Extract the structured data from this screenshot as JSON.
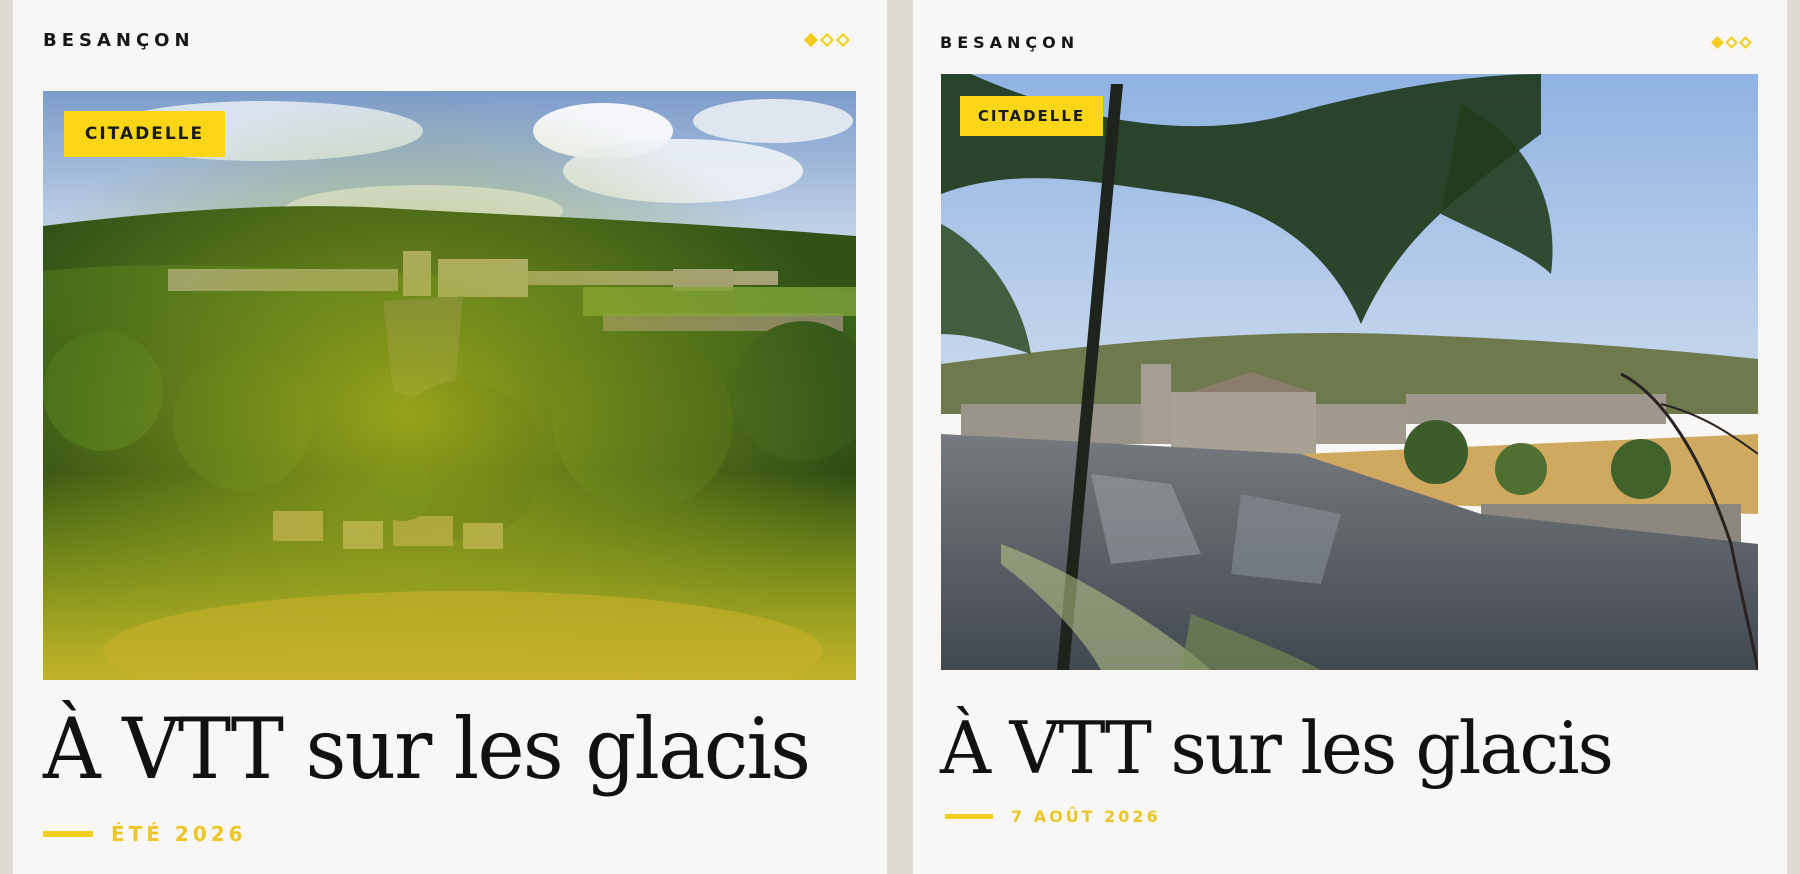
{
  "cards": [
    {
      "brand": "BESANÇON",
      "tag": "CITADELLE",
      "title": "À VTT sur les glacis",
      "date": "ÉTÉ 2026",
      "photo": "citadel-on-green-hillside"
    },
    {
      "brand": "BESANÇON",
      "tag": "CITADELLE",
      "title": "À VTT sur les glacis",
      "date": "7 AOÛT 2026",
      "photo": "citadel-through-tree-branches"
    }
  ],
  "colors": {
    "accent": "#f3cd1e",
    "tag_bg": "#fad616",
    "card_bg": "#f8f7f5",
    "page_bg": "#dedbd4",
    "text": "#111111"
  }
}
